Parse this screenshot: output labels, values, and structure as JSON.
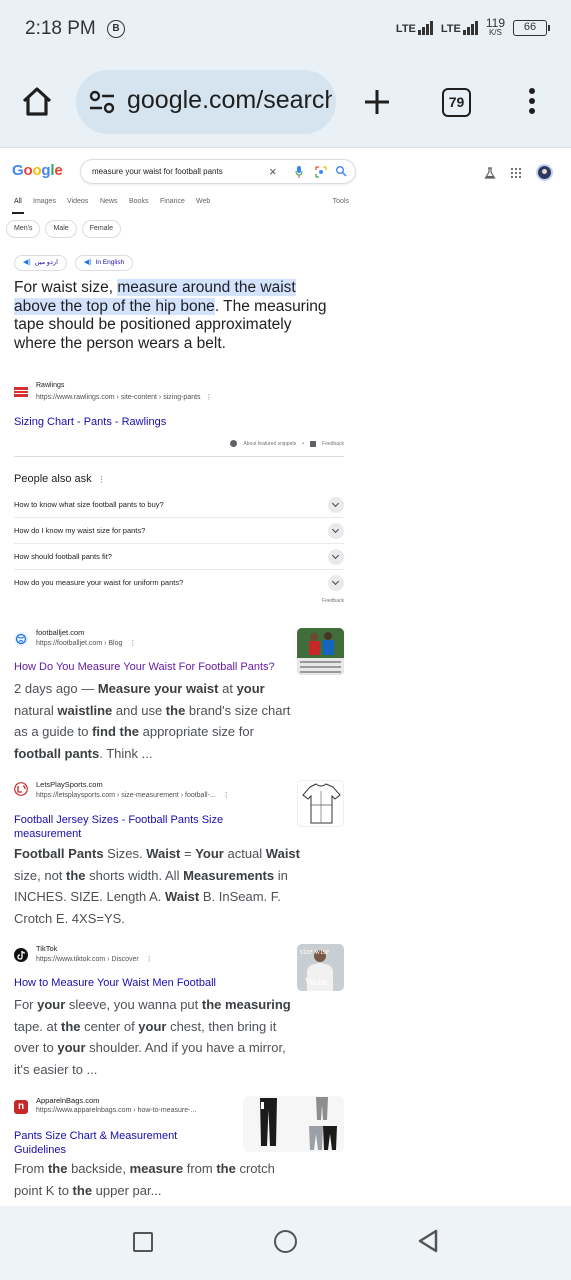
{
  "status_bar": {
    "time": "2:18 PM",
    "b_badge": "B",
    "lte1": "LTE",
    "lte2": "LTE",
    "speed_value": "119",
    "speed_unit": "K/S",
    "battery": "66"
  },
  "toolbar": {
    "url": "google.com/search",
    "tab_count": "79"
  },
  "google": {
    "logo": "Google",
    "logo_colors": [
      "#4285F4",
      "#EA4335",
      "#FBBC05",
      "#4285F4",
      "#34A853",
      "#EA4335"
    ],
    "query": "measure your waist for football pants",
    "clear_icon": "×",
    "tabs": [
      "All",
      "Images",
      "Videos",
      "News",
      "Books",
      "Finance",
      "Web"
    ],
    "tools": "Tools",
    "chips": [
      "Men's",
      "Male",
      "Female"
    ],
    "lang_chips": [
      "اردو میں",
      "In English"
    ]
  },
  "snippet": {
    "pre": "For waist size, ",
    "highlight": "measure around the waist above the top of the hip bone",
    "post": ". The measuring tape should be positioned approximately where the person wears a belt.",
    "source_name": "Rawlings",
    "source_url": "https://www.rawlings.com › site-content › sizing-pants",
    "link_title": "Sizing Chart - Pants - Rawlings",
    "about": "About featured snippets",
    "dot": "•",
    "feedback": "Feedback"
  },
  "paa": {
    "title": "People also ask",
    "questions": [
      "How to know what size football pants to buy?",
      "How do I know my waist size for pants?",
      "How should football pants fit?",
      "How do you measure your waist for uniform pants?"
    ],
    "feedback": "Feedback"
  },
  "results": [
    {
      "name": "footballjet.com",
      "url": "https://footballjet.com › Blog",
      "title": "How Do You Measure Your Waist For Football Pants?",
      "snippet_html": "2 days ago — <b>Measure your waist</b> at <b>your</b> natural <b>waistline</b> and use <b>the</b> brand's size chart as a guide to <b>find the</b> appropriate size for <b>football pants</b>. Think ..."
    },
    {
      "name": "LetsPlaySports.com",
      "url": "https://letsplaysports.com › size-measurement › football-...",
      "title": "Football Jersey Sizes - Football Pants Size measurement",
      "snippet_html": "<b>Football Pants</b> Sizes. <b>Waist</b> = <b>Your</b> actual <b>Waist</b> size, not <b>the</b> shorts width. All <b>Measurements</b> in INCHES. SIZE. Length A. <b>Waist</b> B. InSeam. F. Crotch E. 4XS=YS."
    },
    {
      "name": "TikTok",
      "url": "https://www.tiktok.com › Discover",
      "title": "How to Measure Your Waist Men Football",
      "thumb_text_top": "size wise",
      "thumb_text_bottom": "Waist",
      "snippet_html": "For <b>your</b> sleeve, you wanna put <b>the measuring</b> tape. at <b>the</b> center of <b>your</b> chest, then bring it over to <b>your</b> shoulder. And if you have a mirror, it's easier to ..."
    },
    {
      "name": "ApparelnBags.com",
      "url": "https://www.apparelnbags.com › how-to-measure-...",
      "title": "Pants Size Chart & Measurement Guidelines",
      "snippet_html": "From <b>the</b> backside, <b>measure</b> from <b>the</b> crotch point K to <b>the</b> upper par..."
    }
  ],
  "colors": {
    "link": "#1a0dab",
    "visited": "#681da8",
    "highlight": "#d3e3fd",
    "chrome_bg": "#e9f0f6"
  }
}
